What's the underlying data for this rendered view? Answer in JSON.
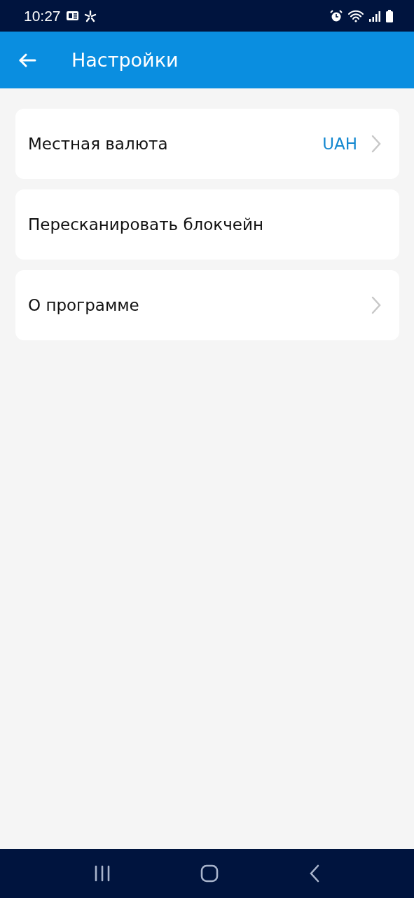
{
  "status_bar": {
    "time": "10:27"
  },
  "app_bar": {
    "title": "Настройки"
  },
  "settings": [
    {
      "label": "Местная валюта",
      "value": "UAH",
      "chevron": true
    },
    {
      "label": "Пересканировать блокчейн",
      "chevron": false
    },
    {
      "label": "О программе",
      "chevron": true
    }
  ]
}
